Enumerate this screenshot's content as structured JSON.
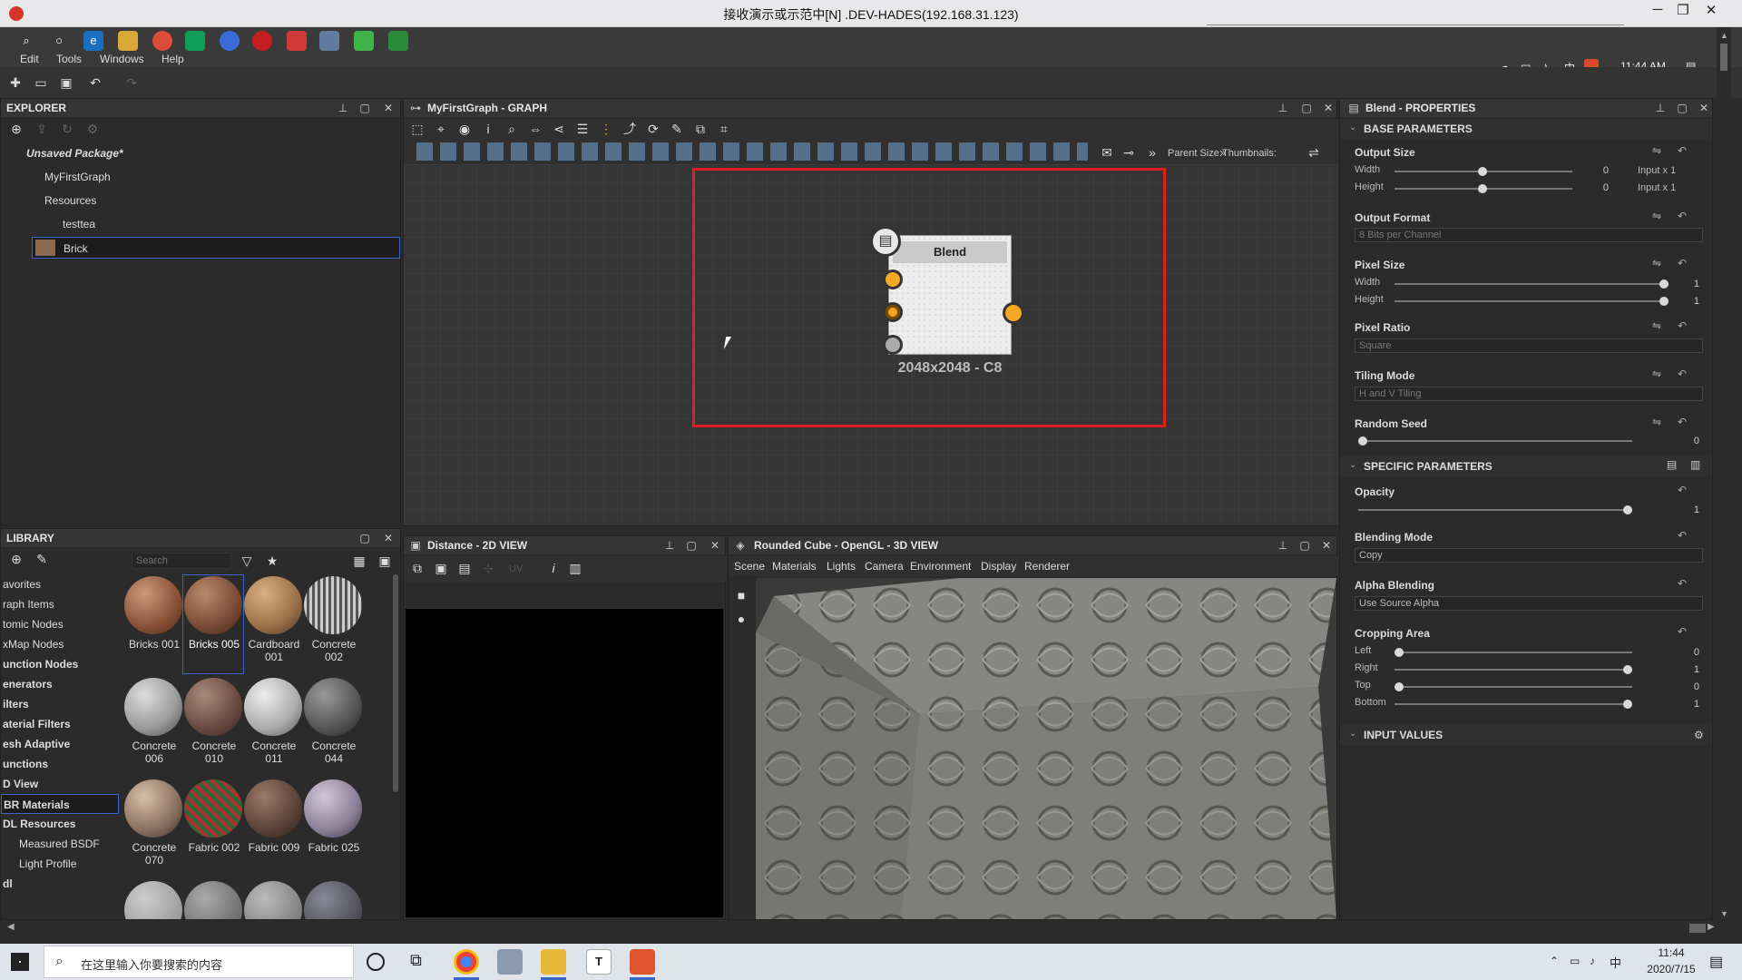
{
  "window": {
    "title": "接收演示或示范中[N] .DEV-HADES(192.168.31.123)",
    "minimize": "─",
    "restore": "❐",
    "close": "✕"
  },
  "menu": {
    "edit": "Edit",
    "tools": "Tools",
    "windows": "Windows",
    "help": "Help"
  },
  "tray": {
    "time": "11:44 AM",
    "ime": "中"
  },
  "explorer": {
    "title": "EXPLORER",
    "package": "Unsaved Package*",
    "items": [
      "MyFirstGraph",
      "Resources",
      "testtea",
      "Brick"
    ],
    "info": "i"
  },
  "library": {
    "title": "LIBRARY",
    "search_placeholder": "Search",
    "categories": [
      "avorites",
      "raph Items",
      "tomic Nodes",
      "xMap Nodes",
      "unction Nodes",
      "enerators",
      "ilters",
      "aterial Filters",
      "esh Adaptive",
      "unctions",
      "D View",
      "BR Materials",
      "DL Resources",
      "Measured BSDF",
      "Light Profile",
      "dl"
    ],
    "thumbs": [
      "Bricks 001",
      "Bricks 005",
      "Cardboard 001",
      "Concrete 002",
      "Concrete 006",
      "Concrete 010",
      "Concrete 011",
      "Concrete 044",
      "Concrete 070",
      "Fabric 002",
      "Fabric 009",
      "Fabric 025"
    ]
  },
  "graph": {
    "title": "MyFirstGraph - GRAPH",
    "parent_size": "Parent Size:",
    "thumbnails": "Thumbnails:",
    "node_title": "Blend",
    "node_info": "2048x2048 - C8"
  },
  "view2d": {
    "title": "Distance - 2D VIEW",
    "uv": "UV"
  },
  "view3d": {
    "title": "Rounded Cube - OpenGL - 3D VIEW",
    "menus": [
      "Scene",
      "Materials",
      "Lights",
      "Camera",
      "Environment",
      "Display",
      "Renderer"
    ]
  },
  "properties": {
    "title": "Blend - PROPERTIES",
    "base_header": "BASE PARAMETERS",
    "output_size": {
      "label": "Output Size",
      "width": "Width",
      "height": "Height",
      "w_val": "0",
      "h_val": "0",
      "w_mode": "Input x 1",
      "h_mode": "Input x 1"
    },
    "output_format": {
      "label": "Output Format",
      "value": "8 Bits per Channel"
    },
    "pixel_size": {
      "label": "Pixel Size",
      "width": "Width",
      "height": "Height",
      "w_val": "1",
      "h_val": "1"
    },
    "pixel_ratio": {
      "label": "Pixel Ratio",
      "value": "Square"
    },
    "tiling_mode": {
      "label": "Tiling Mode",
      "value": "H and V Tiling"
    },
    "random_seed": {
      "label": "Random Seed",
      "value": "0"
    },
    "specific_header": "SPECIFIC PARAMETERS",
    "opacity": {
      "label": "Opacity",
      "value": "1"
    },
    "blending_mode": {
      "label": "Blending Mode",
      "value": "Copy"
    },
    "alpha_blending": {
      "label": "Alpha Blending",
      "value": "Use Source Alpha"
    },
    "cropping": {
      "label": "Cropping Area",
      "left": "Left",
      "right": "Right",
      "top": "Top",
      "bottom": "Bottom",
      "left_val": "0",
      "right_val": "1",
      "top_val": "0",
      "bottom_val": "1"
    },
    "input_header": "INPUT VALUES"
  },
  "taskbar": {
    "search_placeholder": "在这里输入你要搜索的内容",
    "time": "11:44",
    "date": "2020/7/15",
    "ime": "中"
  },
  "colors": {
    "accent": "#f5a623",
    "selection": "#3a66c8",
    "highlight": "#e02020"
  }
}
